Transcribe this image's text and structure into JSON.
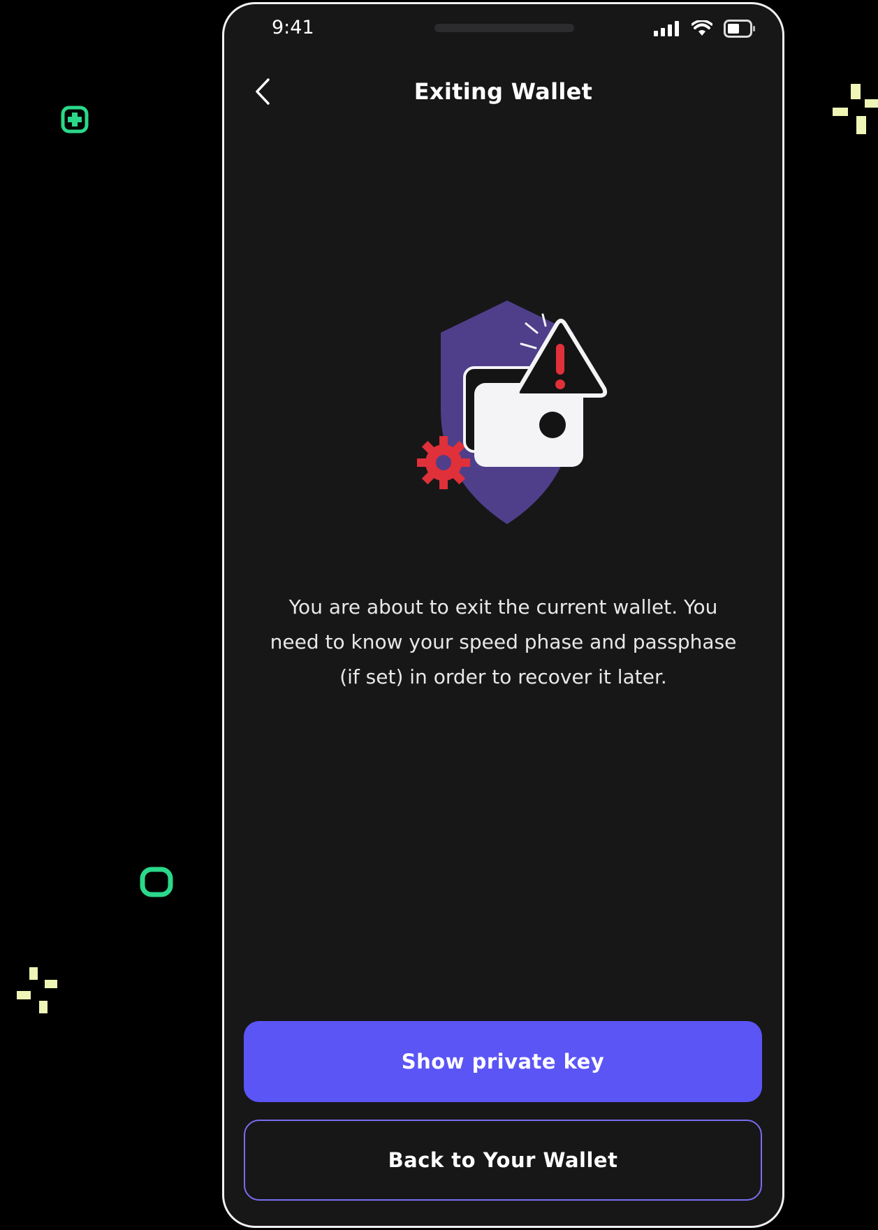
{
  "status_bar": {
    "time": "9:41"
  },
  "header": {
    "title": "Exiting Wallet"
  },
  "message": "You are about to exit the current wallet. You need to know your speed phase and passphase (if set) in order to recover it later.",
  "buttons": {
    "primary_label": "Show private key",
    "secondary_label": "Back to Your Wallet"
  },
  "colors": {
    "background": "#000000",
    "phone_surface": "#171718",
    "primary_button": "#5b55f6",
    "secondary_border": "#7a6df0",
    "shield": "#4f3f8a",
    "alert_red": "#e0303a",
    "decor_green": "#2bd88a",
    "decor_yellow": "#eef5b6"
  },
  "icons": [
    "back-chevron-icon",
    "signal-icon",
    "wifi-icon",
    "battery-icon",
    "shield-wallet-warning-illustration"
  ]
}
